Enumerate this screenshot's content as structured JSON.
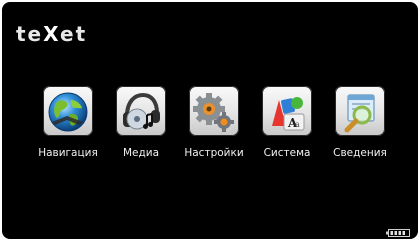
{
  "brand": {
    "logo_left": "te",
    "logo_x": "X",
    "logo_right": "et"
  },
  "apps": [
    {
      "label": "Навигация",
      "icon": "globe-icon"
    },
    {
      "label": "Медиа",
      "icon": "headphones-music-icon"
    },
    {
      "label": "Настройки",
      "icon": "gears-icon"
    },
    {
      "label": "Система",
      "icon": "system-icon"
    },
    {
      "label": "Сведения",
      "icon": "magnifier-window-icon"
    }
  ],
  "status": {
    "battery_icon": "battery-icon"
  },
  "colors": {
    "background": "#000000",
    "text": "#f2f2f2"
  }
}
